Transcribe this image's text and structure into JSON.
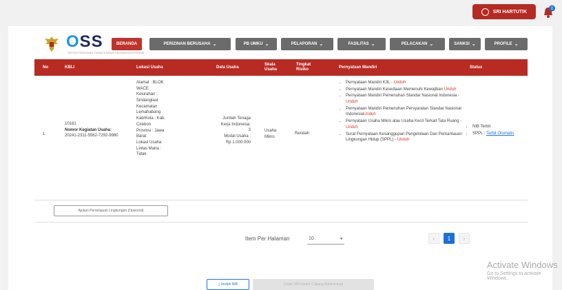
{
  "header": {
    "user_label": "SRI HARTUTIK",
    "notification_count": "0"
  },
  "brand": {
    "logo_text_o": "O",
    "logo_text_rest": "SS",
    "subtitle": "SISTEM PERIZINAN TERINTEGRASI SECARA ELEKTRONIK"
  },
  "nav": [
    {
      "label": "BERANDA"
    },
    {
      "label": "PERIZINAN BERUSAHA"
    },
    {
      "label": "PB UMKU"
    },
    {
      "label": "PELAPORAN"
    },
    {
      "label": "FASILITAS"
    },
    {
      "label": "PELACAKAN"
    },
    {
      "label": "SANKSI"
    },
    {
      "label": "PROFILE"
    }
  ],
  "table": {
    "headers": {
      "no": "No",
      "kbli": "KBLI",
      "lokasi": "Lokasi Usaha",
      "data": "Data Usaha",
      "skala": "Skala Usaha",
      "tingkat": "Tingkat Risiko",
      "pernyataan": "Pernyataan Mandiri",
      "status": "Status"
    },
    "row": {
      "no": "1",
      "kbli_code": "10181",
      "kbli_label": "Nomor Kegiatan Usaha:",
      "kbli_number": "20241-2311-5562-7292-9980",
      "lokasi": [
        "Alamat : BLOK",
        "WACE",
        "Kelurahan :",
        "Sindanglaut",
        "Kecamatan :",
        "Lemahabang",
        "Kab/Kota : Kab.",
        "Cirebon",
        "Provinsi : Jawa",
        "Barat",
        "Lokasi Usaha",
        "Lintas Matra :",
        "Tidak"
      ],
      "data": [
        "Jumlah Tenaga",
        "Kerja Indonesia:",
        "3",
        "Modal Usaha :",
        "Rp 1.000.000"
      ],
      "skala": "Usaha Mikro",
      "tingkat": "Rendah",
      "pernyataan": [
        {
          "text": "Pernyataan Mandiri K3L - ",
          "link": "Unduh"
        },
        {
          "text": "Pernyataan Mandiri Kesediaan Memenuhi Kewajiban ",
          "link": "Unduh"
        },
        {
          "text": "Pernyataan Mandiri Pemenuhan Standar Nasional Indonesia - ",
          "link": "Unduh"
        },
        {
          "text": "Pernyataan Mandiri Pemenuhan Persyaratan Standar Nasional Indonesia",
          "link": "Unduh"
        },
        {
          "text": "Pernyataan Usaha Mikro atau Usaha Kecil Terkait Tata Ruang - ",
          "link": "Unduh"
        },
        {
          "text": "Surat Pernyataan Kesanggupan Pengelolaan Dan Pemantauan Lingkungan Hidup (SPPL) - ",
          "link": "Unduh"
        }
      ],
      "status": [
        {
          "text": "NIB Terbit",
          "link": ""
        },
        {
          "text": "SPPL : ",
          "link": "Terbit Otomatis"
        }
      ]
    },
    "footer_button": "Ajukan Persetujuan Lingkungan (Opsional)"
  },
  "pagination": {
    "items_per_page_label": "Item Per Halaman",
    "items_per_page_value": "10",
    "prev": "‹",
    "current": "1",
    "next": "›"
  },
  "watermark": {
    "title": "Activate Windows",
    "subtitle": "Go to Settings to activate Windows."
  },
  "actions": {
    "unduh_nib": "Unduh NIB",
    "cetak": "Cetak NIB Kantor Cabang Administrasi"
  }
}
